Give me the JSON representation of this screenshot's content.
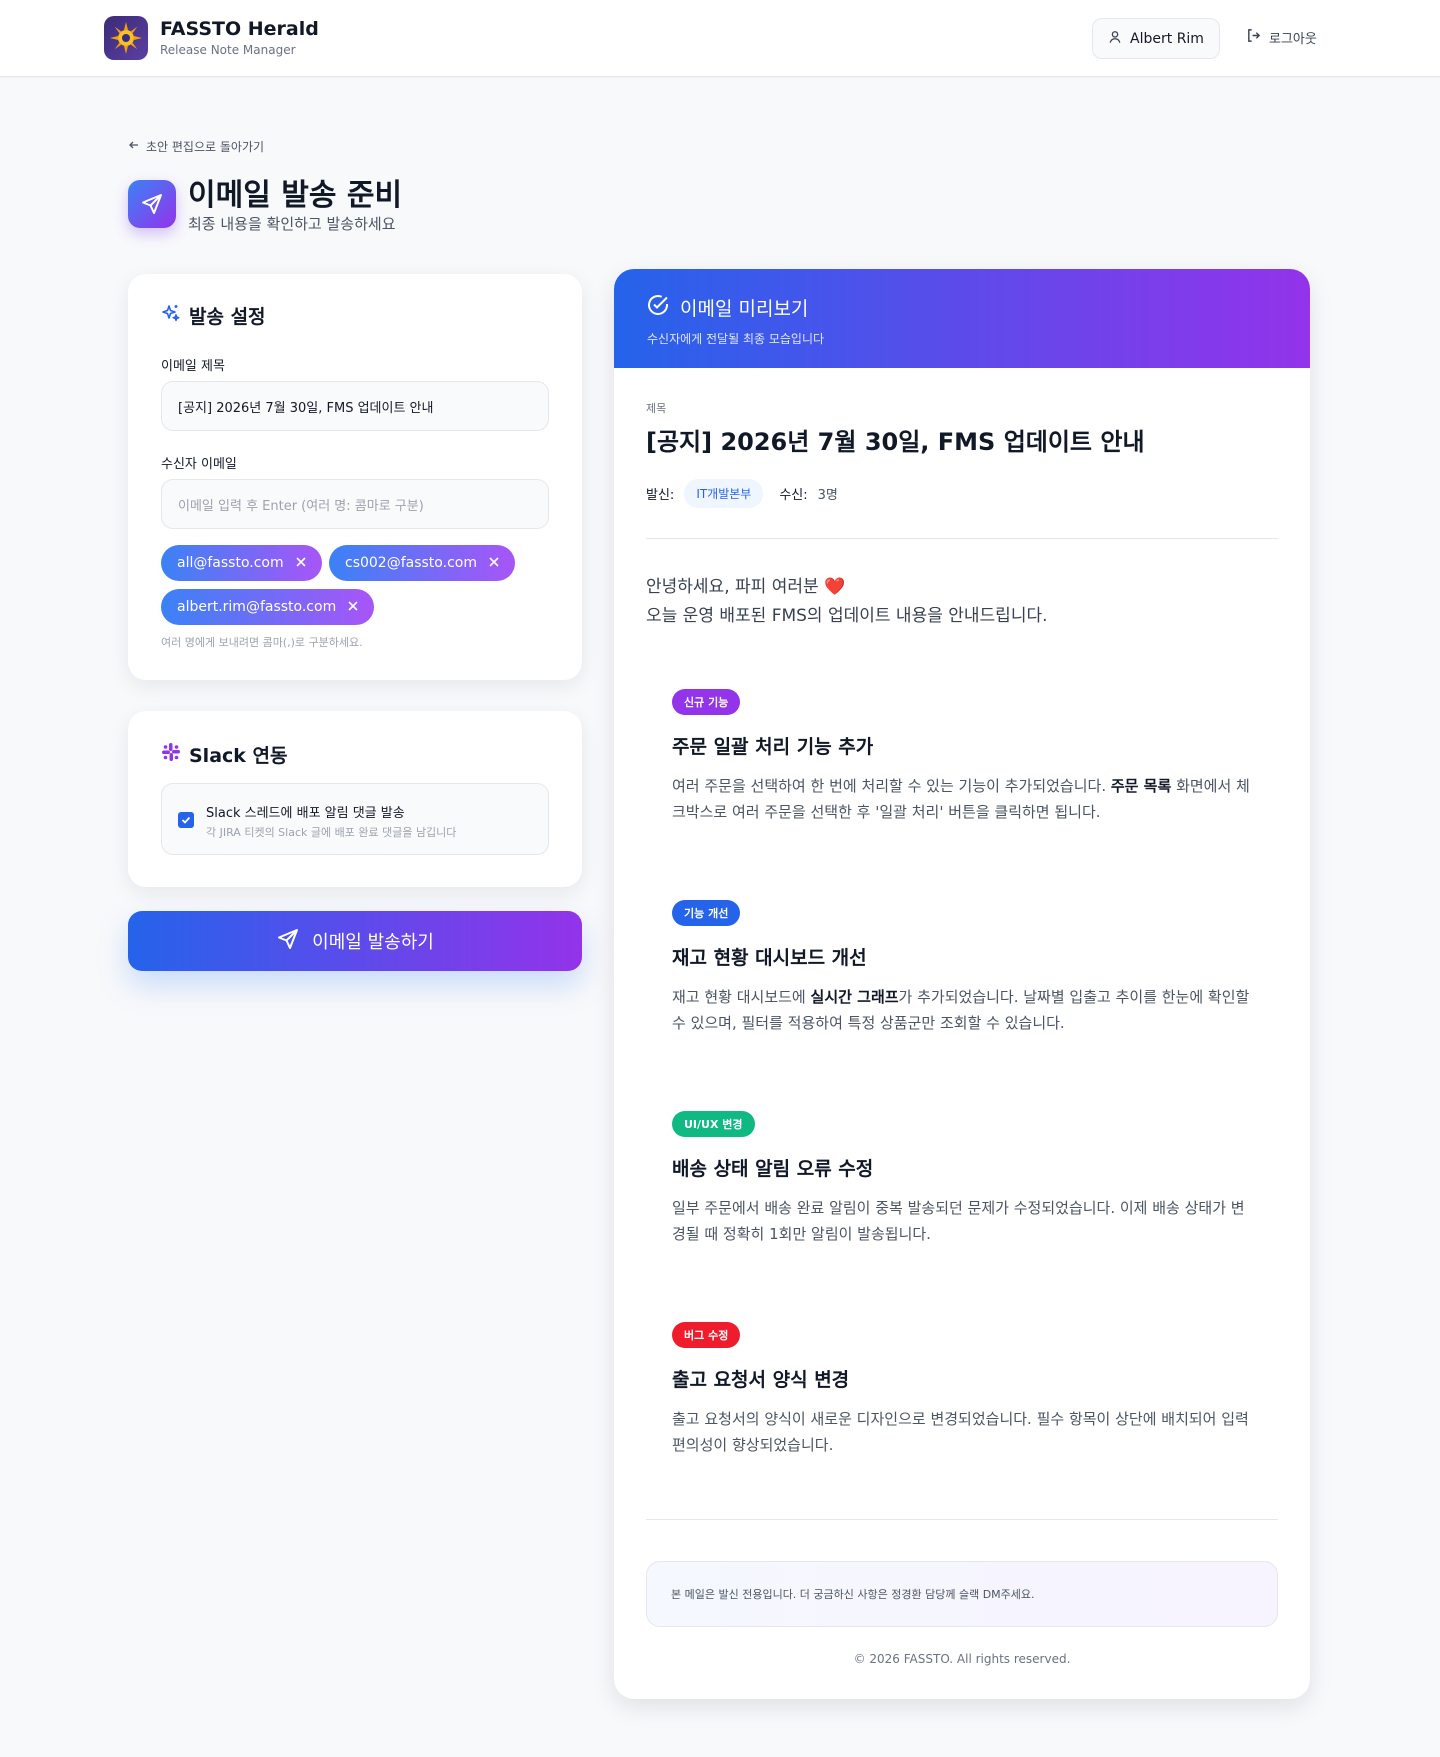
{
  "header": {
    "brand_title": "FASSTO Herald",
    "brand_subtitle": "Release Note Manager",
    "user_name": "Albert Rim",
    "logout_label": "로그아웃"
  },
  "page": {
    "back_label": "초안 편집으로 돌아가기",
    "title": "이메일 발송 준비",
    "subtitle": "최종 내용을 확인하고 발송하세요"
  },
  "settings": {
    "heading": "발송 설정",
    "subject_label": "이메일 제목",
    "subject_value": "[공지] 2026년 7월 30일, FMS 업데이트 안내",
    "recipients_label": "수신자 이메일",
    "recipients_placeholder": "이메일 입력 후 Enter (여러 명: 콤마로 구분)",
    "recipients": [
      "all@fassto.com",
      "cs002@fassto.com",
      "albert.rim@fassto.com"
    ],
    "hint": "여러 명에게 보내려면 콤마(,)로 구분하세요."
  },
  "slack": {
    "heading": "Slack 연동",
    "option_label": "Slack 스레드에 배포 알림 댓글 발송",
    "option_desc": "각 JIRA 티켓의 Slack 글에 배포 완료 댓글을 남깁니다",
    "checked": true
  },
  "send_button_label": "이메일 발송하기",
  "preview": {
    "title": "이메일 미리보기",
    "subtitle": "수신자에게 전달될 최종 모습입니다",
    "subject_label": "제목",
    "subject": "[공지] 2026년 7월 30일, FMS 업데이트 안내",
    "sender_label": "발신:",
    "sender": "IT개발본부",
    "recipients_label": "수신:",
    "recipients_count": "3명",
    "greeting_line1": "안녕하세요, 파피 여러분 ❤️",
    "greeting_line2": "오늘 운영 배포된 FMS의 업데이트 내용을 안내드립니다.",
    "sections": [
      {
        "badge": "신규 기능",
        "badge_color": "#9333ea",
        "title": "주문 일괄 처리 기능 추가",
        "body_pre": "여러 주문을 선택하여 한 번에 처리할 수 있는 기능이 추가되었습니다. ",
        "body_bold": "주문 목록",
        "body_post": " 화면에서 체크박스로 여러 주문을 선택한 후 '일괄 처리' 버튼을 클릭하면 됩니다."
      },
      {
        "badge": "기능 개선",
        "badge_color": "#2563eb",
        "title": "재고 현황 대시보드 개선",
        "body_pre": "재고 현황 대시보드에 ",
        "body_bold": "실시간 그래프",
        "body_post": "가 추가되었습니다. 날짜별 입출고 추이를 한눈에 확인할 수 있으며, 필터를 적용하여 특정 상품군만 조회할 수 있습니다."
      },
      {
        "badge": "UI/UX 변경",
        "badge_color": "#10b981",
        "title": "배송 상태 알림 오류 수정",
        "body_pre": "일부 주문에서 배송 완료 알림이 중복 발송되던 문제가 수정되었습니다. 이제 배송 상태가 변경될 때 정확히 1회만 알림이 발송됩니다.",
        "body_bold": "",
        "body_post": ""
      },
      {
        "badge": "버그 수정",
        "badge_color": "#ef1d2c",
        "title": "출고 요청서 양식 변경",
        "body_pre": "출고 요청서의 양식이 새로운 디자인으로 변경되었습니다. 필수 항목이 상단에 배치되어 입력 편의성이 향상되었습니다.",
        "body_bold": "",
        "body_post": ""
      }
    ],
    "footer_note": "본 메일은 발신 전용입니다. 더 궁금하신 사항은 정경환 담당께 슬랙 DM주세요.",
    "copyright": "© 2026 FASSTO. All rights reserved."
  }
}
